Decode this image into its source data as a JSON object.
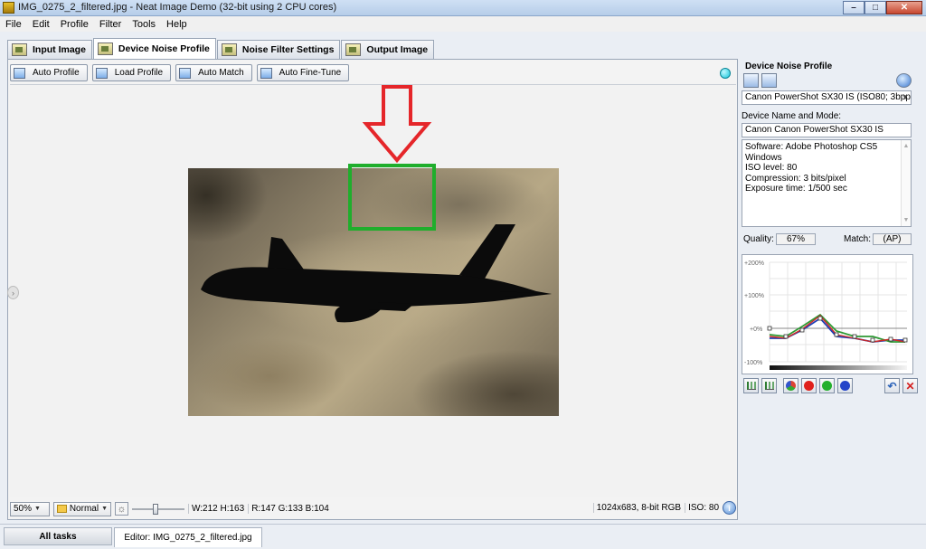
{
  "window": {
    "title": "IMG_0275_2_filtered.jpg - Neat Image Demo (32-bit using 2 CPU cores)",
    "controls": {
      "minimize": "–",
      "maximize": "□",
      "close": "✕"
    }
  },
  "menu": [
    "File",
    "Edit",
    "Profile",
    "Filter",
    "Tools",
    "Help"
  ],
  "tabs": [
    {
      "label": "Input Image",
      "icon": "image-icon",
      "active": false
    },
    {
      "label": "Device Noise Profile",
      "icon": "profile-icon",
      "active": true
    },
    {
      "label": "Noise Filter Settings",
      "icon": "sliders-icon",
      "active": false
    },
    {
      "label": "Output Image",
      "icon": "output-image-icon",
      "active": false
    }
  ],
  "toolbar": {
    "auto_profile": "Auto Profile",
    "load_profile": "Load Profile",
    "auto_match": "Auto Match",
    "auto_fine_tune": "Auto Fine-Tune"
  },
  "status": {
    "zoom": "50%",
    "mode": "Normal",
    "selection": "W:212 H:163",
    "rgb": "R:147 G:133 B:104",
    "image_info": "1024x683, 8-bit RGB",
    "iso": "ISO: 80",
    "slider_level": 0.45
  },
  "profile_panel": {
    "title": "Device Noise Profile",
    "profile_select": "Canon PowerShot SX30 IS (ISO80; 3bpp; 4:",
    "device_label": "Device Name and Mode:",
    "device_value": "Canon Canon PowerShot SX30 IS",
    "details": [
      "Software: Adobe Photoshop CS5 Windows",
      "ISO level: 80",
      "Compression: 3 bits/pixel",
      "Exposure time: 1/500 sec"
    ],
    "quality_label": "Quality:",
    "quality_value": "67%",
    "match_label": "Match:",
    "match_value": "(AP)",
    "graph_ticks": [
      "+200%",
      "+100%",
      "+0%",
      "-100%"
    ]
  },
  "colors": {
    "selection_box": "#1fae2c",
    "arrow": "#e5262a",
    "status_dot": "#11c5da"
  },
  "taskbar": {
    "all_tasks": "All tasks",
    "editor": "Editor: IMG_0275_2_filtered.jpg"
  }
}
